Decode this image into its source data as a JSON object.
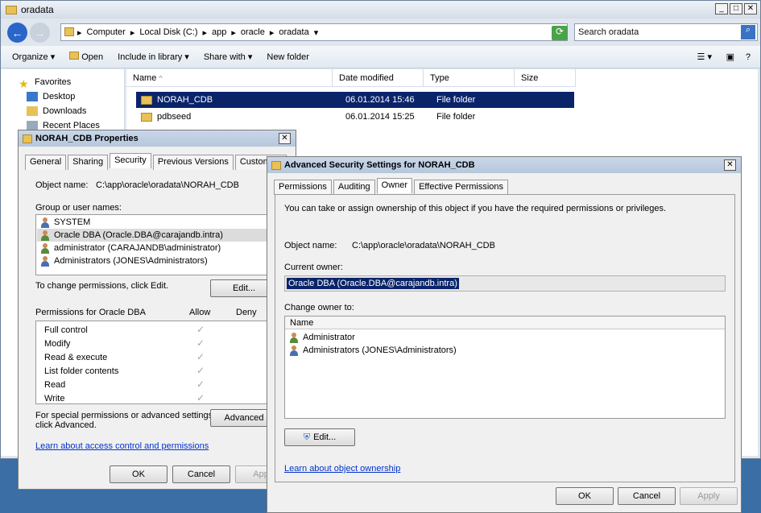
{
  "explorer": {
    "title": "oradata",
    "breadcrumb": [
      "Computer",
      "Local Disk (C:)",
      "app",
      "oracle",
      "oradata"
    ],
    "search_placeholder": "Search oradata",
    "toolbar": {
      "organize": "Organize",
      "open": "Open",
      "include_in_library": "Include in library",
      "share_with": "Share with",
      "new_folder": "New folder"
    },
    "nav": {
      "favorites": "Favorites",
      "desktop": "Desktop",
      "downloads": "Downloads",
      "recent_places": "Recent Places"
    },
    "columns": {
      "name": "Name",
      "date_modified": "Date modified",
      "type": "Type",
      "size": "Size"
    },
    "files": [
      {
        "name": "NORAH_CDB",
        "date": "06.01.2014 15:46",
        "type": "File folder"
      },
      {
        "name": "pdbseed",
        "date": "06.01.2014 15:25",
        "type": "File folder"
      }
    ]
  },
  "props": {
    "title": "NORAH_CDB Properties",
    "tabs": [
      "General",
      "Sharing",
      "Security",
      "Previous Versions",
      "Customize"
    ],
    "object_name_label": "Object name:",
    "object_name_value": "C:\\app\\oracle\\oradata\\NORAH_CDB",
    "group_label": "Group or user names:",
    "users": [
      "SYSTEM",
      "Oracle DBA (Oracle.DBA@carajandb.intra)",
      "administrator (CARAJANDB\\administrator)",
      "Administrators (JONES\\Administrators)"
    ],
    "change_perm_text": "To change permissions, click Edit.",
    "edit_label": "Edit...",
    "permissions_for": "Permissions for Oracle DBA",
    "allow_label": "Allow",
    "deny_label": "Deny",
    "permissions": [
      "Full control",
      "Modify",
      "Read & execute",
      "List folder contents",
      "Read",
      "Write"
    ],
    "special_text_1": "For special permissions or advanced settings,",
    "special_text_2": "click Advanced.",
    "advanced_label": "Advanced",
    "learn_link": "Learn about access control and permissions",
    "ok": "OK",
    "cancel": "Cancel",
    "apply": "Apply"
  },
  "adv": {
    "title": "Advanced Security Settings for NORAH_CDB",
    "tabs": [
      "Permissions",
      "Auditing",
      "Owner",
      "Effective Permissions"
    ],
    "info": "You can take or assign ownership of this object if you have the required permissions or privileges.",
    "object_name_label": "Object name:",
    "object_name_value": "C:\\app\\oracle\\oradata\\NORAH_CDB",
    "current_owner_label": "Current owner:",
    "current_owner_value": "Oracle DBA (Oracle.DBA@carajandb.intra)",
    "change_owner_label": "Change owner to:",
    "name_header": "Name",
    "owners": [
      "Administrator",
      "Administrators (JONES\\Administrators)"
    ],
    "edit_label": "Edit...",
    "learn_link": "Learn about object ownership",
    "ok": "OK",
    "cancel": "Cancel",
    "apply": "Apply"
  }
}
